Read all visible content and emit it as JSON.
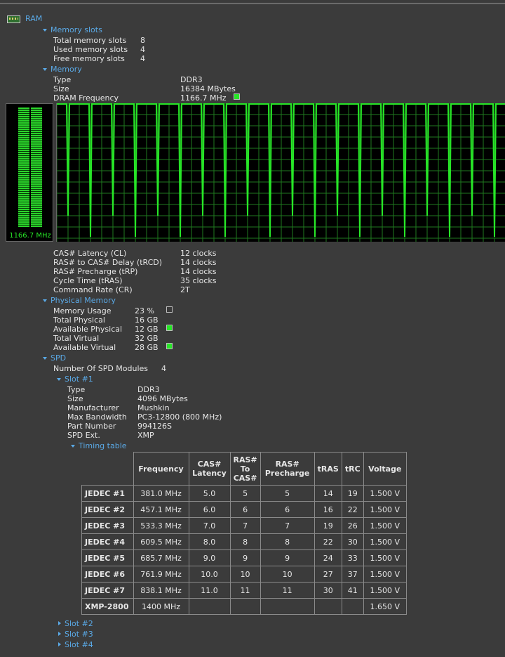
{
  "root": {
    "label": "RAM",
    "icon": "ram-module-icon"
  },
  "memory_slots": {
    "label": "Memory slots",
    "rows": [
      {
        "key": "Total memory slots",
        "value": "8"
      },
      {
        "key": "Used memory slots",
        "value": "4"
      },
      {
        "key": "Free memory slots",
        "value": "4"
      }
    ]
  },
  "memory": {
    "label": "Memory",
    "rows": [
      {
        "key": "Type",
        "value": "DDR3"
      },
      {
        "key": "Size",
        "value": "16384 MBytes"
      },
      {
        "key": "DRAM Frequency",
        "value": "1166.7 MHz"
      }
    ],
    "gauge_label": "1166.7 MHz",
    "timings": [
      {
        "key": "CAS# Latency (CL)",
        "value": "12 clocks"
      },
      {
        "key": "RAS# to CAS# Delay (tRCD)",
        "value": "14 clocks"
      },
      {
        "key": "RAS# Precharge (tRP)",
        "value": "14 clocks"
      },
      {
        "key": "Cycle Time (tRAS)",
        "value": "35 clocks"
      },
      {
        "key": "Command Rate (CR)",
        "value": "2T"
      }
    ]
  },
  "physical_memory": {
    "label": "Physical Memory",
    "rows": [
      {
        "key": "Memory Usage",
        "value": "23 %"
      },
      {
        "key": "Total Physical",
        "value": "16 GB"
      },
      {
        "key": "Available Physical",
        "value": "12 GB"
      },
      {
        "key": "Total Virtual",
        "value": "32 GB"
      },
      {
        "key": "Available Virtual",
        "value": "28 GB"
      }
    ]
  },
  "spd": {
    "label": "SPD",
    "modules": {
      "key": "Number Of SPD Modules",
      "value": "4"
    },
    "slot1": {
      "label": "Slot #1",
      "rows": [
        {
          "key": "Type",
          "value": "DDR3"
        },
        {
          "key": "Size",
          "value": "4096 MBytes"
        },
        {
          "key": "Manufacturer",
          "value": "Mushkin"
        },
        {
          "key": "Max Bandwidth",
          "value": "PC3-12800 (800 MHz)"
        },
        {
          "key": "Part Number",
          "value": "994126S"
        },
        {
          "key": "SPD Ext.",
          "value": "XMP"
        }
      ],
      "timing_table": {
        "label": "Timing table",
        "headers": [
          "Frequency",
          "CAS# Latency",
          "RAS# To CAS#",
          "RAS# Precharge",
          "tRAS",
          "tRC",
          "Voltage"
        ],
        "rows": [
          {
            "name": "JEDEC #1",
            "cells": [
              "381.0 MHz",
              "5.0",
              "5",
              "5",
              "14",
              "19",
              "1.500 V"
            ]
          },
          {
            "name": "JEDEC #2",
            "cells": [
              "457.1 MHz",
              "6.0",
              "6",
              "6",
              "16",
              "22",
              "1.500 V"
            ]
          },
          {
            "name": "JEDEC #3",
            "cells": [
              "533.3 MHz",
              "7.0",
              "7",
              "7",
              "19",
              "26",
              "1.500 V"
            ]
          },
          {
            "name": "JEDEC #4",
            "cells": [
              "609.5 MHz",
              "8.0",
              "8",
              "8",
              "22",
              "30",
              "1.500 V"
            ]
          },
          {
            "name": "JEDEC #5",
            "cells": [
              "685.7 MHz",
              "9.0",
              "9",
              "9",
              "24",
              "33",
              "1.500 V"
            ]
          },
          {
            "name": "JEDEC #6",
            "cells": [
              "761.9 MHz",
              "10.0",
              "10",
              "10",
              "27",
              "37",
              "1.500 V"
            ]
          },
          {
            "name": "JEDEC #7",
            "cells": [
              "838.1 MHz",
              "11.0",
              "11",
              "11",
              "30",
              "41",
              "1.500 V"
            ]
          },
          {
            "name": "XMP-2800",
            "cells": [
              "1400 MHz",
              "",
              "",
              "",
              "",
              "",
              "1.650 V"
            ]
          }
        ]
      }
    },
    "other_slots": [
      "Slot #2",
      "Slot #3",
      "Slot #4"
    ]
  },
  "colors": {
    "accent": "#5aa9e6",
    "graph": "#27e627",
    "background": "#3b3b3b"
  }
}
